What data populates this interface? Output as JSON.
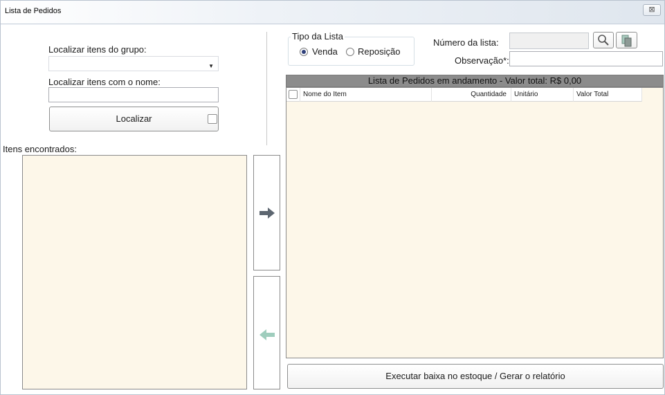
{
  "window": {
    "title": "Lista de Pedidos",
    "close_glyph": "⊠"
  },
  "search": {
    "group_label": "Localizar itens do grupo:",
    "group_value": "",
    "name_label": "Localizar itens com o nome:",
    "name_value": "",
    "locate_button": "Localizar",
    "found_label": "Itens encontrados:"
  },
  "list_type": {
    "title": "Tipo da Lista",
    "options": [
      {
        "label": "Venda",
        "selected": true
      },
      {
        "label": "Reposição",
        "selected": false
      }
    ]
  },
  "form": {
    "list_number_label": "Número da lista:",
    "list_number_value": "",
    "observation_label": "Observação*:",
    "observation_value": "",
    "search_icon": "magnifier-icon",
    "copy_icon": "copy-document-icon"
  },
  "orders": {
    "header": "Lista de Pedidos em andamento - Valor total: R$ 0,00",
    "columns": [
      "Nome do Item",
      "Quantidade",
      "Unitário",
      "Valor Total"
    ],
    "rows": []
  },
  "actions": {
    "execute_button": "Executar baixa no estoque / Gerar o relatório",
    "add_arrow": "arrow-right-icon",
    "remove_arrow": "arrow-left-icon"
  },
  "colors": {
    "list_background": "#fdf7e9",
    "header_bar": "#8c8c8c",
    "arrow_right": "#5d6670",
    "arrow_left": "#9fcdbd"
  }
}
